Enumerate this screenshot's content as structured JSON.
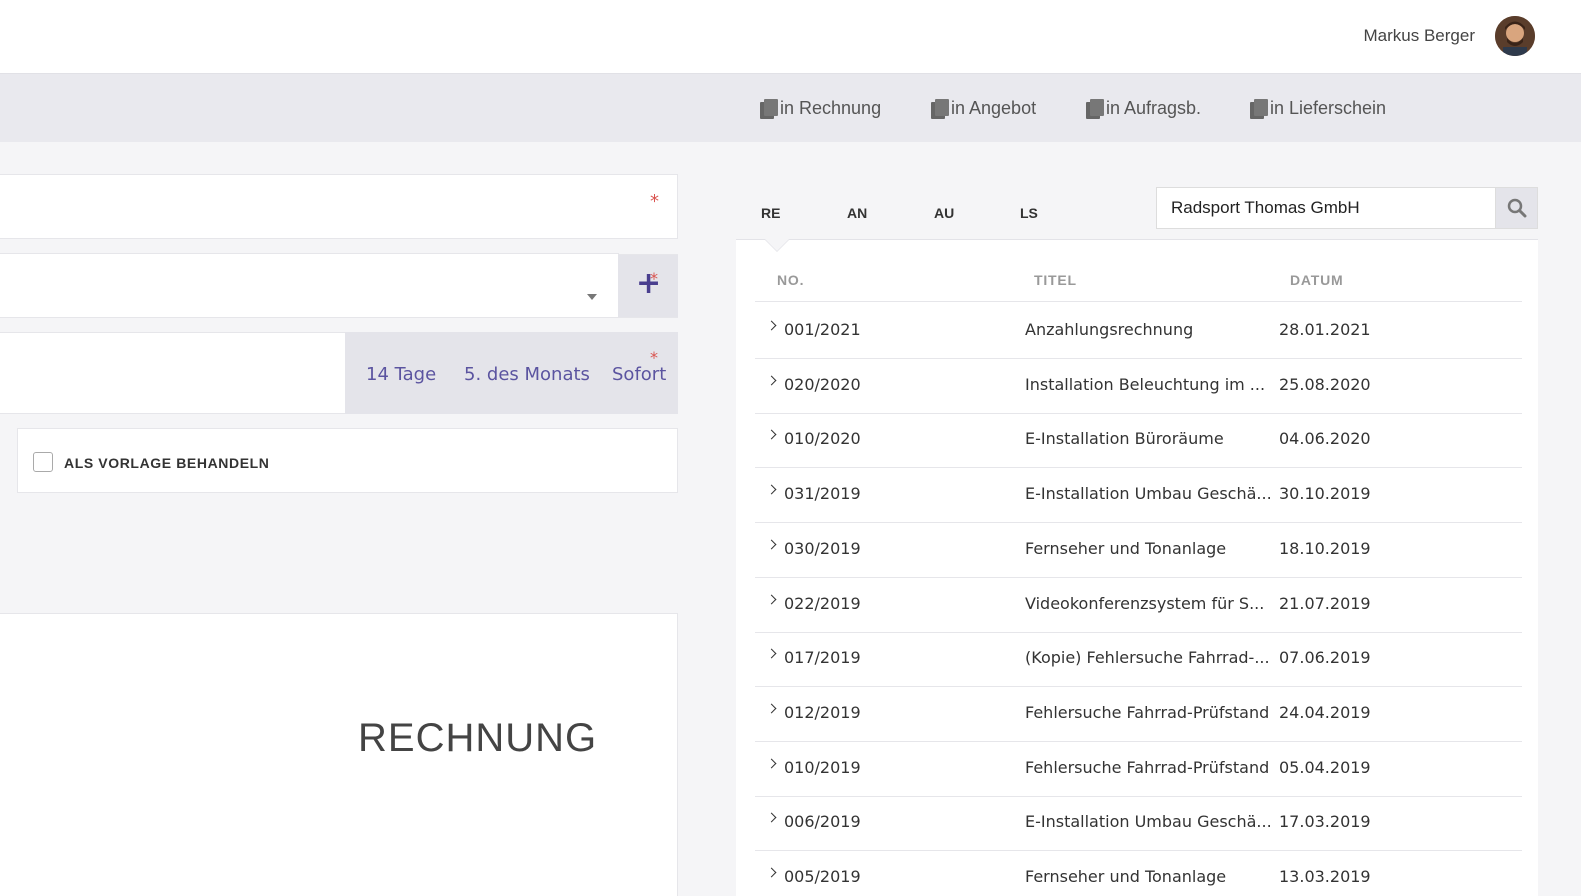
{
  "header": {
    "user_name": "Markus Berger"
  },
  "toolbar": {
    "buttons": [
      {
        "label": "in Rechnung"
      },
      {
        "label": "in Angebot"
      },
      {
        "label": "in Aufragsb."
      },
      {
        "label": "in Lieferschein"
      }
    ]
  },
  "form": {
    "required_mark": "*",
    "plus_label": "+",
    "payment_terms": [
      "14 Tage",
      "5. des Monats",
      "Sofort"
    ],
    "template_checkbox_label": "ALS VORLAGE BEHANDELN",
    "document_title": "RECHNUNG"
  },
  "documents": {
    "tabs": [
      "RE",
      "AN",
      "AU",
      "LS"
    ],
    "active_tab": "RE",
    "search_value": "Radsport Thomas GmbH",
    "columns": [
      "NO.",
      "TITEL",
      "DATUM"
    ],
    "rows": [
      {
        "no": "001/2021",
        "title": "Anzahlungsrechnung",
        "date": "28.01.2021"
      },
      {
        "no": "020/2020",
        "title": "Installation Beleuchtung im ...",
        "date": "25.08.2020"
      },
      {
        "no": "010/2020",
        "title": "E-Installation Büroräume",
        "date": "04.06.2020"
      },
      {
        "no": "031/2019",
        "title": "E-Installation Umbau Geschä...",
        "date": "30.10.2019"
      },
      {
        "no": "030/2019",
        "title": "Fernseher und Tonanlage",
        "date": "18.10.2019"
      },
      {
        "no": "022/2019",
        "title": "Videokonferenzsystem für S...",
        "date": "21.07.2019"
      },
      {
        "no": "017/2019",
        "title": "(Kopie) Fehlersuche Fahrrad-...",
        "date": "07.06.2019"
      },
      {
        "no": "012/2019",
        "title": "Fehlersuche Fahrrad-Prüfstand",
        "date": "24.04.2019"
      },
      {
        "no": "010/2019",
        "title": "Fehlersuche Fahrrad-Prüfstand",
        "date": "05.04.2019"
      },
      {
        "no": "006/2019",
        "title": "E-Installation Umbau Geschä...",
        "date": "17.03.2019"
      },
      {
        "no": "005/2019",
        "title": "Fernseher und Tonanlage",
        "date": "13.03.2019"
      }
    ]
  },
  "colors": {
    "accent": "#5b54a0",
    "required": "#d9534f",
    "toolbar_bg": "#e9e9ee"
  },
  "icons": [
    "copy-icon",
    "search-icon",
    "chevron-right-icon",
    "plus-icon",
    "dropdown-caret-icon"
  ]
}
